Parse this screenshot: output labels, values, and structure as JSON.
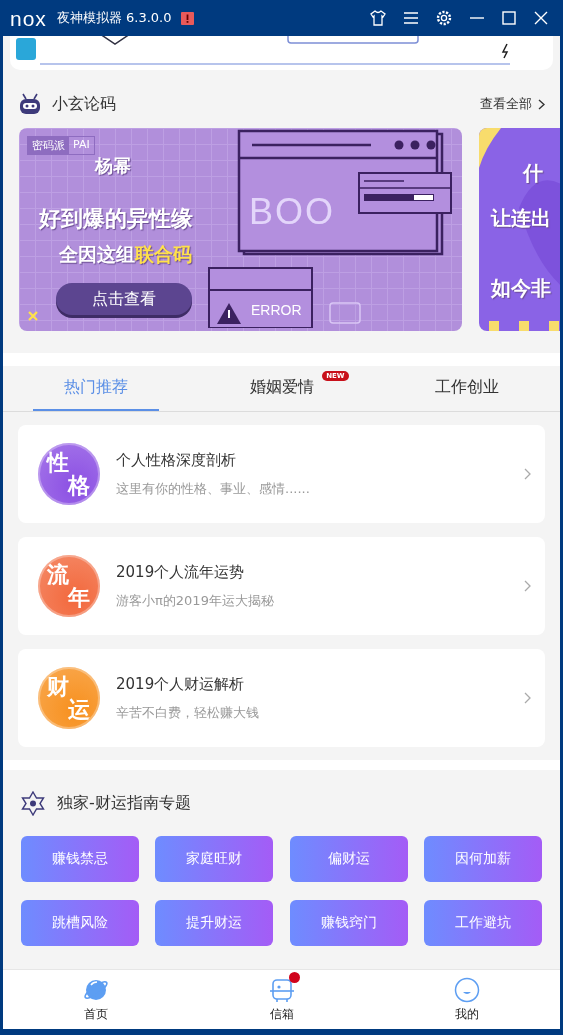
{
  "window": {
    "logo": "nox",
    "title": "夜神模拟器 6.3.0.0"
  },
  "featured": {
    "title": "小玄论码",
    "more": "查看全部",
    "banners": [
      {
        "kind": "main",
        "tag": "密码派",
        "tag_en": "PAI",
        "lines": [
          "杨幂",
          "好到爆的异性缘"
        ],
        "line3": "全因这组",
        "highlight": "联合码",
        "button": "点击查看",
        "art_word": "BOO",
        "error": "ERROR"
      },
      {
        "kind": "side",
        "lines": [
          "什",
          "让连出",
          "如今非"
        ]
      }
    ]
  },
  "tabs": [
    {
      "label": "热门推荐",
      "selected": true,
      "new": false
    },
    {
      "label": "婚姻爱情",
      "selected": false,
      "new": true,
      "new_label": "NEW"
    },
    {
      "label": "工作创业",
      "selected": false,
      "new": false
    }
  ],
  "cards": [
    {
      "icon_chars": [
        "性",
        "格"
      ],
      "color": "#8b4fe3",
      "title": "个人性格深度剖析",
      "subtitle": "这里有你的性格、事业、感情......"
    },
    {
      "icon_chars": [
        "流",
        "年"
      ],
      "color": "#f2683c",
      "title": "2019个人流年运势",
      "subtitle": "游客小π的2019年运大揭秘"
    },
    {
      "icon_chars": [
        "财",
        "运"
      ],
      "color": "#f7901e",
      "title": "2019个人财运解析",
      "subtitle": "辛苦不白费，轻松赚大钱"
    }
  ],
  "guide": {
    "title": "独家-财运指南专题",
    "buttons": [
      "赚钱禁忌",
      "家庭旺财",
      "偏财运",
      "因何加薪",
      "跳槽风险",
      "提升财运",
      "赚钱窍门",
      "工作避坑"
    ]
  },
  "bottom_nav": [
    {
      "label": "首页",
      "kind": "home",
      "dot": false
    },
    {
      "label": "信箱",
      "kind": "mail",
      "dot": true
    },
    {
      "label": "我的",
      "kind": "me",
      "dot": false
    }
  ]
}
